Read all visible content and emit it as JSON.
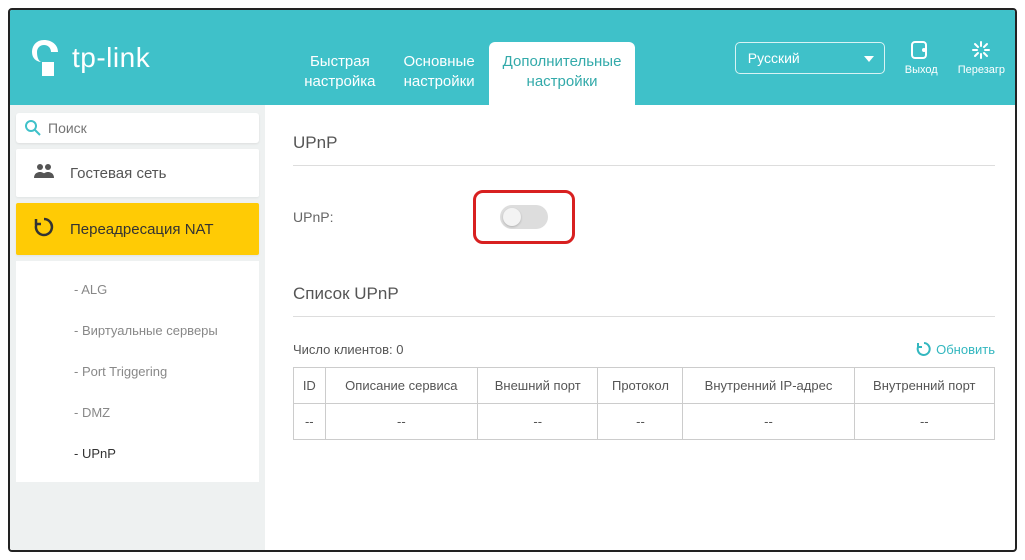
{
  "header": {
    "brand": "tp-link",
    "tabs": [
      {
        "line1": "Быстрая",
        "line2": "настройка"
      },
      {
        "line1": "Основные",
        "line2": "настройки"
      },
      {
        "line1": "Дополнительные",
        "line2": "настройки"
      }
    ],
    "active_tab": 2,
    "language": "Русский",
    "logout": "Выход",
    "reboot": "Перезагр"
  },
  "sidebar": {
    "search_placeholder": "Поиск",
    "items": [
      {
        "label": "Гостевая сеть"
      },
      {
        "label": "Переадресация NAT"
      }
    ],
    "active_item": 1,
    "sub_items": [
      {
        "label": "- ALG"
      },
      {
        "label": "- Виртуальные серверы"
      },
      {
        "label": "- Port Triggering"
      },
      {
        "label": "- DMZ"
      },
      {
        "label": "- UPnP"
      }
    ],
    "active_sub": 4
  },
  "content": {
    "section1_title": "UPnP",
    "upnp_label": "UPnP:",
    "section2_title": "Список UPnP",
    "clients_label": "Число клиентов: 0",
    "refresh_label": "Обновить",
    "table_headers": [
      "ID",
      "Описание сервиса",
      "Внешний порт",
      "Протокол",
      "Внутренний IP-адрес",
      "Внутренний порт"
    ],
    "empty_cell": "--"
  }
}
